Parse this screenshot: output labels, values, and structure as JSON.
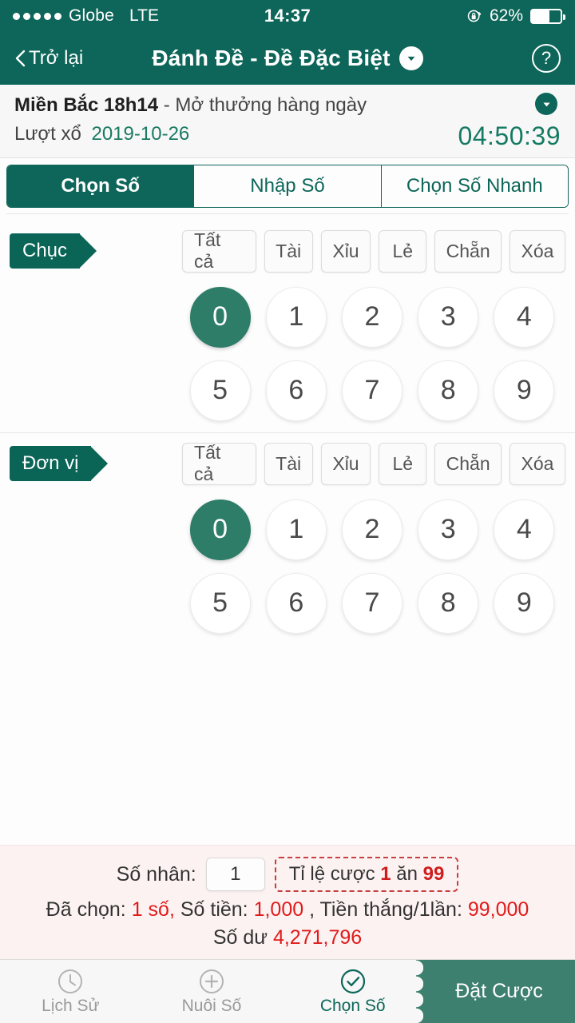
{
  "status_bar": {
    "carrier": "Globe",
    "network": "LTE",
    "time": "14:37",
    "battery_percent": "62%",
    "battery_level": 62,
    "signal_dots": 5,
    "rotation_lock_icon": "lock-rotation-icon"
  },
  "header": {
    "back_label": "Trở lại",
    "title": "Đánh Đề - Đề Đặc Biệt",
    "dropdown_icon": "caret-down-icon",
    "help_label": "?",
    "bg_color": "#0d6659"
  },
  "draw_info": {
    "region": "Miền Bắc 18h14",
    "schedule": "- Mở thưởng hàng ngày",
    "draw_label": "Lượt xổ",
    "draw_date": "2019-10-26",
    "countdown": "04:50:39",
    "expand_icon": "caret-down-icon"
  },
  "tabs": [
    {
      "label": "Chọn Số",
      "active": true
    },
    {
      "label": "Nhập Số",
      "active": false
    },
    {
      "label": "Chọn Số Nhanh",
      "active": false
    }
  ],
  "filter_buttons": [
    "Tất cả",
    "Tài",
    "Xỉu",
    "Lẻ",
    "Chẵn",
    "Xóa"
  ],
  "panels": [
    {
      "tag": "Chục",
      "numbers": [
        "0",
        "1",
        "2",
        "3",
        "4",
        "5",
        "6",
        "7",
        "8",
        "9"
      ],
      "selected": [
        "0"
      ]
    },
    {
      "tag": "Đơn vị",
      "numbers": [
        "0",
        "1",
        "2",
        "3",
        "4",
        "5",
        "6",
        "7",
        "8",
        "9"
      ],
      "selected": [
        "0"
      ]
    }
  ],
  "summary": {
    "multiplier_label": "Số nhân:",
    "multiplier_value": "1",
    "multiplier_placeholder": "1",
    "odds_prefix": "Tỉ lệ cược",
    "odds_stake": "1",
    "odds_mid": "ăn",
    "odds_payout": "99",
    "chosen_label": "Đã chọn:",
    "chosen_count": "1 số,",
    "amount_label": "Số tiền:",
    "amount_value": "1,000",
    "win_label": ", Tiền thắng/1lần:",
    "win_value": "99,000",
    "balance_label": "Số dư",
    "balance_value": "4,271,796",
    "accent_red": "#e01b1b"
  },
  "bottom_nav": {
    "items": [
      {
        "label": "Lịch Sử",
        "icon": "clock-icon",
        "active": false
      },
      {
        "label": "Nuôi Số",
        "icon": "plus-circle-icon",
        "active": false
      },
      {
        "label": "Chọn Số",
        "icon": "check-circle-icon",
        "active": true
      }
    ],
    "bet_button": "Đặt Cược"
  }
}
